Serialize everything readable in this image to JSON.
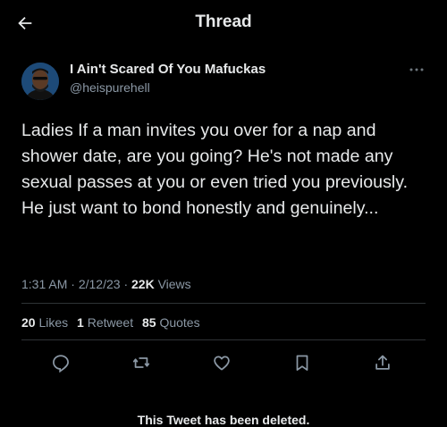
{
  "header": {
    "title": "Thread",
    "back_icon": "arrow-left-icon"
  },
  "tweet": {
    "author": {
      "name": "I Ain't Scared Of You Mafuckas",
      "handle": "@heispurehell"
    },
    "text": "Ladies If a man invites you over for a nap and shower date, are you going? He's not made any sexual passes at you or even tried you previously. He just want to bond honestly and genuinely...",
    "time": "1:31 AM",
    "date": "2/12/23",
    "separator": "·",
    "views_count": "22K",
    "views_label": "Views",
    "stats": {
      "likes_count": "20",
      "likes_label": "Likes",
      "retweets_count": "1",
      "retweets_label": "Retweet",
      "quotes_count": "85",
      "quotes_label": "Quotes"
    },
    "actions": [
      "reply-icon",
      "retweet-icon",
      "like-icon",
      "bookmark-icon",
      "share-icon"
    ]
  },
  "notice": {
    "deleted_text": "This Tweet has been deleted."
  },
  "colors": {
    "background": "#000000",
    "text_primary": "#e7e9ea",
    "text_secondary": "#8b98a5",
    "divider": "#2f3336"
  }
}
